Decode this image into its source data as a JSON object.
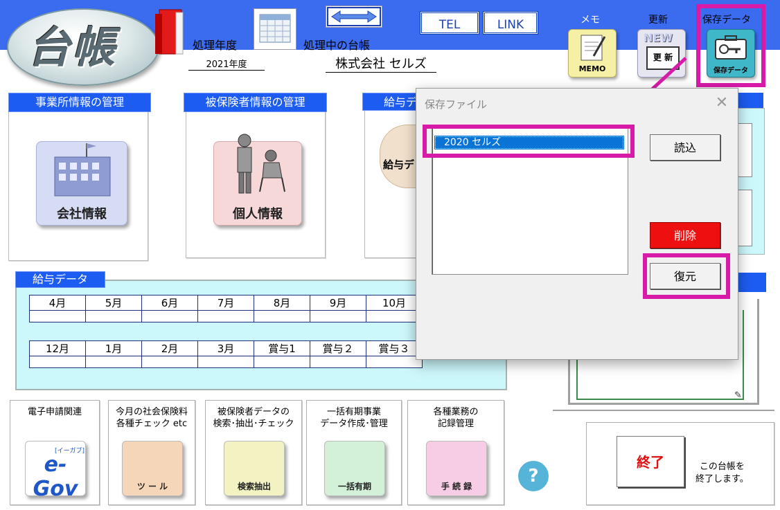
{
  "header": {
    "logo_text": "台帳",
    "processing_year_label": "処理年度",
    "processing_year_value": "2021年度",
    "current_ledger_label": "処理中の台帳",
    "company_name": "株式会社  セルズ",
    "tel_label": "TEL",
    "link_label": "LINK",
    "memo_title": "メモ",
    "memo_icon_text": "MEMO",
    "update_title": "更新",
    "update_icon_text_new": "NEW",
    "update_icon_text": "更 新",
    "save_title": "保存データ",
    "save_icon_text": "保存データ"
  },
  "sections": {
    "office": {
      "tab": "事業所情報の管理",
      "button": "会社情報"
    },
    "insured": {
      "tab": "被保険者情報の管理",
      "button": "個人情報"
    },
    "payroll": {
      "tab": "給与デ",
      "button": "給与デ"
    }
  },
  "salary": {
    "tab": "給与データ",
    "row1": [
      "4月",
      "5月",
      "6月",
      "7月",
      "8月",
      "9月",
      "10月"
    ],
    "row2": [
      "12月",
      "1月",
      "2月",
      "3月",
      "賞与1",
      "賞与２",
      "賞与３"
    ]
  },
  "tiles": [
    {
      "label": "電子申請関連",
      "icon_text": "e-Gov",
      "icon_sub": "[イーガブ]"
    },
    {
      "label": "今月の社会保険料\n各種チェック etc",
      "icon_text": "ツ ー ル"
    },
    {
      "label": "被保険者データの\n検索･抽出･チェック",
      "icon_text": "検索抽出"
    },
    {
      "label": "一括有期事業\nデータ作成･管理",
      "icon_text": "一括有期"
    },
    {
      "label": "各種業務の\n記録管理",
      "icon_text": "手 続 録"
    }
  ],
  "help_icon_text": "?",
  "end": {
    "button": "終了",
    "note": "この台帳を\n終了します。"
  },
  "dialog": {
    "title": "保存ファイル",
    "list_items": [
      "2020 セルズ"
    ],
    "load_button": "読込",
    "delete_button": "削除",
    "restore_button": "復元"
  },
  "colors": {
    "header_blue": "#3b6cf0",
    "tab_blue": "#1c5cf0",
    "annotation_magenta": "#d81aa9",
    "delete_red": "#ee1010",
    "selection_blue": "#0a74d6",
    "salary_bg": "#ccf7fb"
  }
}
